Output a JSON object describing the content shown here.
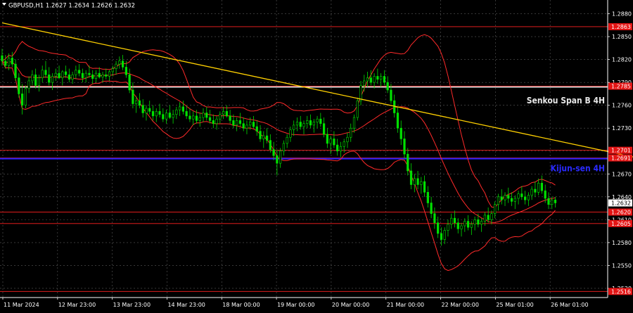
{
  "chart_data": {
    "type": "candlestick",
    "symbol_info": "GBPUSD,H1  1.2627 1.2634 1.2626 1.2632",
    "current_price": 1.2632,
    "ylim": [
      1.2508,
      1.2898
    ],
    "y_ticks": [
      "1.2880",
      "1.2850",
      "1.2820",
      "1.2790",
      "1.2760",
      "1.2730",
      "1.2700",
      "1.2670",
      "1.2640",
      "1.2610",
      "1.2580",
      "1.2550",
      "1.2520"
    ],
    "x_ticks": [
      "11 Mar 2024",
      "12 Mar 23:00",
      "13 Mar 23:00",
      "14 Mar 23:00",
      "18 Mar 00:00",
      "19 Mar 00:00",
      "20 Mar 00:00",
      "21 Mar 00:00",
      "22 Mar 00:00",
      "25 Mar 01:00",
      "26 Mar 01:00"
    ],
    "horizontal_levels": [
      {
        "value": 1.2863,
        "label": "1.2863",
        "color": "#ff2020"
      },
      {
        "value": 1.2785,
        "label": "1.2785",
        "color": "#ff2020"
      },
      {
        "value": 1.2784,
        "label": "",
        "color": "#e6e6e6"
      },
      {
        "value": 1.2701,
        "label": "1.2701",
        "color": "#ff2020"
      },
      {
        "value": 1.2691,
        "label": "1.2691",
        "color": "#ff2020"
      },
      {
        "value": 1.269,
        "label": "",
        "color": "#1f1fff"
      },
      {
        "value": 1.262,
        "label": "1.2620",
        "color": "#ff2020"
      },
      {
        "value": 1.2605,
        "label": "1.2605",
        "color": "#ff2020"
      },
      {
        "value": 1.2516,
        "label": "1.2516",
        "color": "#ff2020"
      }
    ],
    "annotations": [
      {
        "text": "Senkou Span B 4H",
        "value": 1.2766,
        "color": "#e6e6e6"
      },
      {
        "text": "Kijun-sen 4H",
        "value": 1.2677,
        "color": "#2a2aff"
      }
    ],
    "trendline": {
      "start": [
        0,
        1.2868
      ],
      "end": [
        225,
        1.2658
      ],
      "color": "#ffd000"
    },
    "ohlc": [
      [
        1.2825,
        1.2834,
        1.2812,
        1.2818
      ],
      [
        1.2818,
        1.2826,
        1.2808,
        1.2812
      ],
      [
        1.2812,
        1.2828,
        1.2806,
        1.2822
      ],
      [
        1.2822,
        1.283,
        1.281,
        1.2814
      ],
      [
        1.2814,
        1.282,
        1.2792,
        1.2796
      ],
      [
        1.2796,
        1.2802,
        1.277,
        1.2775
      ],
      [
        1.2775,
        1.2788,
        1.2748,
        1.276
      ],
      [
        1.276,
        1.2786,
        1.2756,
        1.2782
      ],
      [
        1.2782,
        1.2798,
        1.2776,
        1.2792
      ],
      [
        1.2792,
        1.2806,
        1.2786,
        1.28
      ],
      [
        1.28,
        1.2808,
        1.2782,
        1.2786
      ],
      [
        1.2786,
        1.28,
        1.2778,
        1.2796
      ],
      [
        1.2796,
        1.2812,
        1.279,
        1.2806
      ],
      [
        1.2806,
        1.2818,
        1.2796,
        1.28
      ],
      [
        1.28,
        1.281,
        1.2786,
        1.279
      ],
      [
        1.279,
        1.2802,
        1.278,
        1.2798
      ],
      [
        1.2798,
        1.2808,
        1.2792,
        1.2802
      ],
      [
        1.2802,
        1.2812,
        1.2794,
        1.2796
      ],
      [
        1.2796,
        1.2806,
        1.2786,
        1.2804
      ],
      [
        1.2804,
        1.2812,
        1.2796,
        1.28
      ],
      [
        1.28,
        1.2808,
        1.279,
        1.2794
      ],
      [
        1.2794,
        1.2804,
        1.2788,
        1.28
      ],
      [
        1.28,
        1.2812,
        1.2795,
        1.2806
      ],
      [
        1.2806,
        1.2814,
        1.2798,
        1.2802
      ],
      [
        1.2802,
        1.2808,
        1.279,
        1.2796
      ],
      [
        1.2796,
        1.2806,
        1.279,
        1.2802
      ],
      [
        1.2802,
        1.2812,
        1.2796,
        1.28
      ],
      [
        1.28,
        1.2806,
        1.2788,
        1.2795
      ],
      [
        1.2795,
        1.2806,
        1.279,
        1.2802
      ],
      [
        1.2802,
        1.281,
        1.2795,
        1.2797
      ],
      [
        1.2797,
        1.2804,
        1.279,
        1.28
      ],
      [
        1.28,
        1.2808,
        1.2794,
        1.2798
      ],
      [
        1.2798,
        1.2806,
        1.2792,
        1.2804
      ],
      [
        1.2804,
        1.2812,
        1.2798,
        1.2808
      ],
      [
        1.2808,
        1.2818,
        1.28,
        1.2814
      ],
      [
        1.2814,
        1.2824,
        1.2808,
        1.2818
      ],
      [
        1.2818,
        1.2826,
        1.2806,
        1.281
      ],
      [
        1.281,
        1.2818,
        1.2796,
        1.28
      ],
      [
        1.28,
        1.2808,
        1.2776,
        1.278
      ],
      [
        1.278,
        1.279,
        1.2756,
        1.2762
      ],
      [
        1.2762,
        1.2772,
        1.275,
        1.2766
      ],
      [
        1.2766,
        1.2776,
        1.2756,
        1.276
      ],
      [
        1.276,
        1.2768,
        1.2744,
        1.275
      ],
      [
        1.275,
        1.276,
        1.274,
        1.2756
      ],
      [
        1.2756,
        1.2766,
        1.2748,
        1.2752
      ],
      [
        1.2752,
        1.276,
        1.274,
        1.2746
      ],
      [
        1.2746,
        1.2756,
        1.2738,
        1.2752
      ],
      [
        1.2752,
        1.2762,
        1.2744,
        1.2748
      ],
      [
        1.2748,
        1.2756,
        1.2738,
        1.2742
      ],
      [
        1.2742,
        1.2754,
        1.2736,
        1.275
      ],
      [
        1.275,
        1.276,
        1.2742,
        1.2744
      ],
      [
        1.2744,
        1.2754,
        1.2736,
        1.2748
      ],
      [
        1.2748,
        1.2758,
        1.2742,
        1.2754
      ],
      [
        1.2754,
        1.2764,
        1.2746,
        1.2758
      ],
      [
        1.2758,
        1.2766,
        1.2748,
        1.2752
      ],
      [
        1.2752,
        1.276,
        1.2742,
        1.2746
      ],
      [
        1.2746,
        1.2756,
        1.2738,
        1.2742
      ],
      [
        1.2742,
        1.2752,
        1.2734,
        1.2746
      ],
      [
        1.2746,
        1.2754,
        1.2736,
        1.274
      ],
      [
        1.274,
        1.275,
        1.2732,
        1.2744
      ],
      [
        1.2744,
        1.2756,
        1.2738,
        1.275
      ],
      [
        1.275,
        1.2758,
        1.274,
        1.2744
      ],
      [
        1.2744,
        1.2754,
        1.2736,
        1.274
      ],
      [
        1.274,
        1.2748,
        1.273,
        1.2736
      ],
      [
        1.2736,
        1.2746,
        1.2728,
        1.2742
      ],
      [
        1.2742,
        1.2752,
        1.2736,
        1.2748
      ],
      [
        1.2748,
        1.2758,
        1.2742,
        1.2752
      ],
      [
        1.2752,
        1.276,
        1.2744,
        1.2746
      ],
      [
        1.2746,
        1.2754,
        1.2736,
        1.274
      ],
      [
        1.274,
        1.2748,
        1.273,
        1.2734
      ],
      [
        1.2734,
        1.2744,
        1.2726,
        1.274
      ],
      [
        1.274,
        1.275,
        1.2732,
        1.2736
      ],
      [
        1.2736,
        1.2744,
        1.2726,
        1.273
      ],
      [
        1.273,
        1.274,
        1.2722,
        1.2734
      ],
      [
        1.2734,
        1.2744,
        1.2728,
        1.2738
      ],
      [
        1.2738,
        1.2746,
        1.273,
        1.2732
      ],
      [
        1.2732,
        1.274,
        1.272,
        1.2726
      ],
      [
        1.2726,
        1.2734,
        1.2712,
        1.2716
      ],
      [
        1.2716,
        1.2726,
        1.2704,
        1.272
      ],
      [
        1.272,
        1.273,
        1.271,
        1.2714
      ],
      [
        1.2714,
        1.2722,
        1.2698,
        1.2702
      ],
      [
        1.2702,
        1.2712,
        1.2688,
        1.2694
      ],
      [
        1.2694,
        1.2702,
        1.2668,
        1.2684
      ],
      [
        1.2684,
        1.2704,
        1.2678,
        1.27
      ],
      [
        1.27,
        1.2714,
        1.2694,
        1.271
      ],
      [
        1.271,
        1.2722,
        1.2704,
        1.2718
      ],
      [
        1.2718,
        1.2732,
        1.2712,
        1.2728
      ],
      [
        1.2728,
        1.274,
        1.272,
        1.2734
      ],
      [
        1.2734,
        1.2744,
        1.2726,
        1.2738
      ],
      [
        1.2738,
        1.2746,
        1.2728,
        1.2732
      ],
      [
        1.2732,
        1.274,
        1.2722,
        1.2736
      ],
      [
        1.2736,
        1.2746,
        1.273,
        1.274
      ],
      [
        1.274,
        1.2748,
        1.273,
        1.2734
      ],
      [
        1.2734,
        1.2742,
        1.2724,
        1.2738
      ],
      [
        1.2738,
        1.2746,
        1.273,
        1.2742
      ],
      [
        1.2742,
        1.275,
        1.2732,
        1.2736
      ],
      [
        1.2736,
        1.2744,
        1.2718,
        1.2722
      ],
      [
        1.2722,
        1.273,
        1.2704,
        1.271
      ],
      [
        1.271,
        1.272,
        1.2696,
        1.2716
      ],
      [
        1.2716,
        1.2726,
        1.2704,
        1.2708
      ],
      [
        1.2708,
        1.2716,
        1.2694,
        1.27
      ],
      [
        1.27,
        1.2712,
        1.2692,
        1.2706
      ],
      [
        1.2706,
        1.2716,
        1.2698,
        1.2712
      ],
      [
        1.2712,
        1.2724,
        1.2704,
        1.2718
      ],
      [
        1.2718,
        1.2736,
        1.2712,
        1.273
      ],
      [
        1.273,
        1.2748,
        1.2724,
        1.2744
      ],
      [
        1.2744,
        1.277,
        1.274,
        1.2766
      ],
      [
        1.2766,
        1.2792,
        1.276,
        1.2786
      ],
      [
        1.2786,
        1.28,
        1.2778,
        1.2792
      ],
      [
        1.2792,
        1.2804,
        1.2784,
        1.2796
      ],
      [
        1.2796,
        1.2806,
        1.2786,
        1.279
      ],
      [
        1.279,
        1.2802,
        1.2782,
        1.2798
      ],
      [
        1.2798,
        1.2808,
        1.2788,
        1.2794
      ],
      [
        1.2794,
        1.2802,
        1.2784,
        1.2798
      ],
      [
        1.2798,
        1.2806,
        1.2786,
        1.279
      ],
      [
        1.279,
        1.2798,
        1.2776,
        1.278
      ],
      [
        1.278,
        1.2788,
        1.2762,
        1.2766
      ],
      [
        1.2766,
        1.2774,
        1.2744,
        1.275
      ],
      [
        1.275,
        1.2758,
        1.2724,
        1.273
      ],
      [
        1.273,
        1.274,
        1.2708,
        1.2716
      ],
      [
        1.2716,
        1.2726,
        1.269,
        1.2696
      ],
      [
        1.2696,
        1.2704,
        1.2668,
        1.2674
      ],
      [
        1.2674,
        1.2684,
        1.265,
        1.2656
      ],
      [
        1.2656,
        1.267,
        1.2646,
        1.2664
      ],
      [
        1.2664,
        1.2674,
        1.265,
        1.2656
      ],
      [
        1.2656,
        1.2666,
        1.2644,
        1.266
      ],
      [
        1.266,
        1.2668,
        1.264,
        1.2646
      ],
      [
        1.2646,
        1.2654,
        1.2626,
        1.2632
      ],
      [
        1.2632,
        1.264,
        1.2612,
        1.2618
      ],
      [
        1.2618,
        1.2626,
        1.2598,
        1.2606
      ],
      [
        1.2606,
        1.2614,
        1.2586,
        1.2592
      ],
      [
        1.2592,
        1.26,
        1.2576,
        1.2584
      ],
      [
        1.2584,
        1.26,
        1.2578,
        1.2596
      ],
      [
        1.2596,
        1.261,
        1.2588,
        1.2604
      ],
      [
        1.2604,
        1.2618,
        1.2598,
        1.2612
      ],
      [
        1.2612,
        1.2622,
        1.26,
        1.2606
      ],
      [
        1.2606,
        1.2612,
        1.2592,
        1.2598
      ],
      [
        1.2598,
        1.2606,
        1.2588,
        1.2602
      ],
      [
        1.2602,
        1.2612,
        1.2594,
        1.2608
      ],
      [
        1.2608,
        1.2616,
        1.2596,
        1.26
      ],
      [
        1.26,
        1.2608,
        1.259,
        1.2604
      ],
      [
        1.2604,
        1.2614,
        1.2596,
        1.261
      ],
      [
        1.261,
        1.2618,
        1.26,
        1.2604
      ],
      [
        1.2604,
        1.2612,
        1.2594,
        1.2608
      ],
      [
        1.2608,
        1.262,
        1.2602,
        1.2616
      ],
      [
        1.2616,
        1.2626,
        1.2606,
        1.261
      ],
      [
        1.261,
        1.2622,
        1.2604,
        1.2618
      ],
      [
        1.2618,
        1.2634,
        1.2612,
        1.263
      ],
      [
        1.263,
        1.2644,
        1.2622,
        1.264
      ],
      [
        1.264,
        1.265,
        1.263,
        1.2636
      ],
      [
        1.2636,
        1.2646,
        1.2628,
        1.2642
      ],
      [
        1.2642,
        1.2652,
        1.2632,
        1.2638
      ],
      [
        1.2638,
        1.2646,
        1.2628,
        1.2634
      ],
      [
        1.2634,
        1.2642,
        1.2624,
        1.2638
      ],
      [
        1.2638,
        1.2648,
        1.263,
        1.2644
      ],
      [
        1.2644,
        1.2654,
        1.2636,
        1.264
      ],
      [
        1.264,
        1.2648,
        1.263,
        1.2636
      ],
      [
        1.2636,
        1.2646,
        1.2628,
        1.2642
      ],
      [
        1.2642,
        1.2654,
        1.2636,
        1.265
      ],
      [
        1.265,
        1.266,
        1.264,
        1.2646
      ],
      [
        1.2646,
        1.2664,
        1.2642,
        1.2658
      ],
      [
        1.2658,
        1.2668,
        1.2644,
        1.2648
      ],
      [
        1.2648,
        1.2656,
        1.2632,
        1.2638
      ],
      [
        1.2638,
        1.2646,
        1.2624,
        1.263
      ],
      [
        1.263,
        1.264,
        1.2624,
        1.2636
      ],
      [
        1.2636,
        1.264,
        1.2626,
        1.2632
      ]
    ]
  }
}
